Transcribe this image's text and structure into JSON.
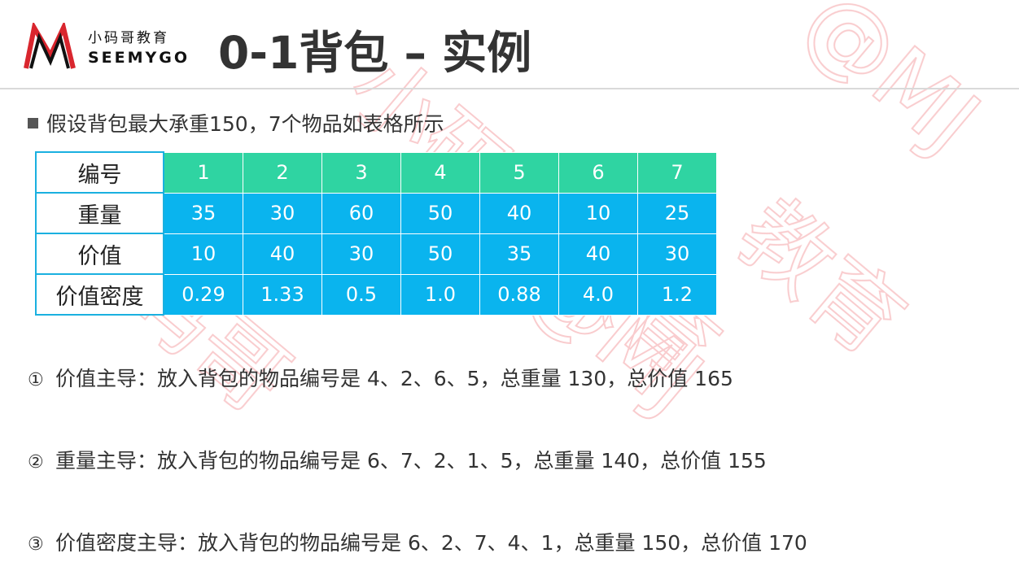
{
  "header": {
    "logo": {
      "brand_cn": "小码哥教育",
      "brand_en": "SEEMYGO"
    },
    "title": "0-1背包 – 实例"
  },
  "intro": "假设背包最大承重150，7个物品如表格所示",
  "table": {
    "rows": [
      {
        "label": "编号",
        "values": [
          "1",
          "2",
          "3",
          "4",
          "5",
          "6",
          "7"
        ]
      },
      {
        "label": "重量",
        "values": [
          "35",
          "30",
          "60",
          "50",
          "40",
          "10",
          "25"
        ]
      },
      {
        "label": "价值",
        "values": [
          "10",
          "40",
          "30",
          "50",
          "35",
          "40",
          "30"
        ]
      },
      {
        "label": "价值密度",
        "values": [
          "0.29",
          "1.33",
          "0.5",
          "1.0",
          "0.88",
          "4.0",
          "1.2"
        ]
      }
    ]
  },
  "strategies": [
    {
      "marker": "①",
      "text": "价值主导：放入背包的物品编号是 4、2、6、5，总重量 130，总价值 165"
    },
    {
      "marker": "②",
      "text": "重量主导：放入背包的物品编号是 6、7、2、1、5，总重量 140，总价值 155"
    },
    {
      "marker": "③",
      "text": "价值密度主导：放入背包的物品编号是 6、2、7、4、1，总重量 150，总价值 170"
    }
  ],
  "colors": {
    "id_row": "#2fd4a2",
    "data_rows": "#0ab4ee",
    "header_border": "#1ab0e0",
    "logo_red": "#d9262e",
    "watermark": "#e8232b"
  }
}
